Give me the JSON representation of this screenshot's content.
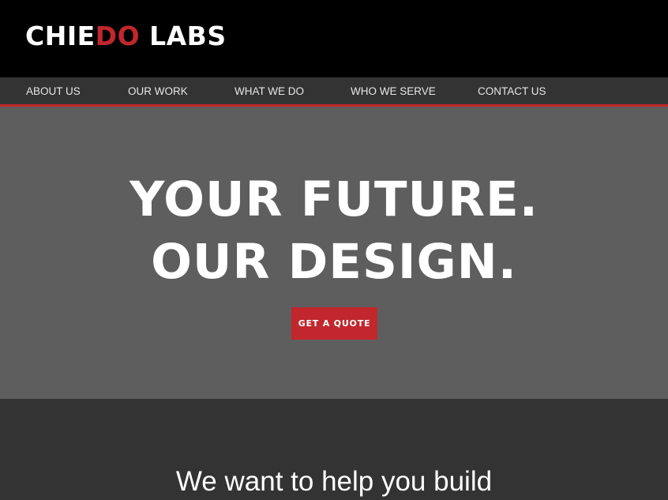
{
  "brand": {
    "logo_part1": "CHIE",
    "logo_accent": "DO",
    "logo_part2": " LABS",
    "accent_color": "#c1272d"
  },
  "nav": {
    "items": [
      {
        "label": "ABOUT US"
      },
      {
        "label": "OUR WORK"
      },
      {
        "label": "WHAT WE DO"
      },
      {
        "label": "WHO WE SERVE"
      },
      {
        "label": "CONTACT US"
      }
    ]
  },
  "hero": {
    "line1": "YOUR FUTURE.",
    "line2": "OUR DESIGN.",
    "cta_label": "GET A QUOTE"
  },
  "intro": {
    "heading": "We want to help you build"
  },
  "colors": {
    "header_bg": "#000000",
    "nav_bg": "#333333",
    "hero_bg": "#5e5e5e",
    "section_bg": "#333333",
    "accent": "#c1272d"
  }
}
